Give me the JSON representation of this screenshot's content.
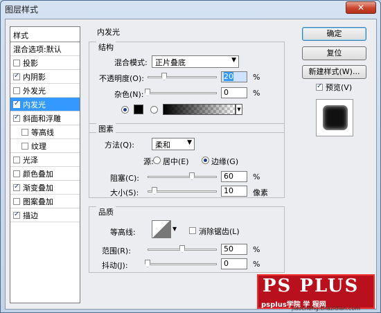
{
  "window": {
    "title": "图层样式",
    "close_glyph": "✕"
  },
  "style_list": {
    "header": "样式",
    "items": [
      {
        "label": "混合选项:默认",
        "checkbox": false,
        "checked": false,
        "selected": false
      },
      {
        "label": "投影",
        "checkbox": true,
        "checked": false,
        "selected": false
      },
      {
        "label": "内阴影",
        "checkbox": true,
        "checked": true,
        "selected": false
      },
      {
        "label": "外发光",
        "checkbox": true,
        "checked": false,
        "selected": false
      },
      {
        "label": "内发光",
        "checkbox": true,
        "checked": true,
        "selected": true
      },
      {
        "label": "斜面和浮雕",
        "checkbox": true,
        "checked": true,
        "selected": false
      },
      {
        "label": "等高线",
        "checkbox": true,
        "checked": false,
        "selected": false,
        "indent": true
      },
      {
        "label": "纹理",
        "checkbox": true,
        "checked": false,
        "selected": false,
        "indent": true
      },
      {
        "label": "光泽",
        "checkbox": true,
        "checked": false,
        "selected": false
      },
      {
        "label": "颜色叠加",
        "checkbox": true,
        "checked": false,
        "selected": false
      },
      {
        "label": "渐变叠加",
        "checkbox": true,
        "checked": true,
        "selected": false
      },
      {
        "label": "图案叠加",
        "checkbox": true,
        "checked": false,
        "selected": false
      },
      {
        "label": "描边",
        "checkbox": true,
        "checked": true,
        "selected": false
      }
    ]
  },
  "panel": {
    "title": "内发光",
    "structure": {
      "title": "结构",
      "blend_mode_label": "混合模式:",
      "blend_mode_value": "正片叠底",
      "opacity_label": "不透明度(O):",
      "opacity_value": "20",
      "opacity_unit": "%",
      "noise_label": "杂色(N):",
      "noise_value": "0",
      "noise_unit": "%",
      "color": "#000000"
    },
    "elements": {
      "title": "图素",
      "technique_label": "方法(Q):",
      "technique_value": "柔和",
      "source_label": "源:",
      "source_center": "居中(E)",
      "source_edge": "边缘(G)",
      "choke_label": "阻塞(C):",
      "choke_value": "60",
      "choke_unit": "%",
      "size_label": "大小(S):",
      "size_value": "10",
      "size_unit": "像素"
    },
    "quality": {
      "title": "品质",
      "contour_label": "等高线:",
      "antialias_label": "消除锯齿(L)",
      "range_label": "范围(R):",
      "range_value": "50",
      "range_unit": "%",
      "jitter_label": "抖动(J):",
      "jitter_value": "0",
      "jitter_unit": "%"
    }
  },
  "buttons": {
    "ok": "确定",
    "reset": "复位",
    "new_style": "新建样式(W)...",
    "preview_label": "预览(V)"
  },
  "watermark": {
    "line1": "PS PLUS",
    "line2": "psplus学院 学 程网",
    "line3": "jiaocheng.chazidian.com"
  }
}
